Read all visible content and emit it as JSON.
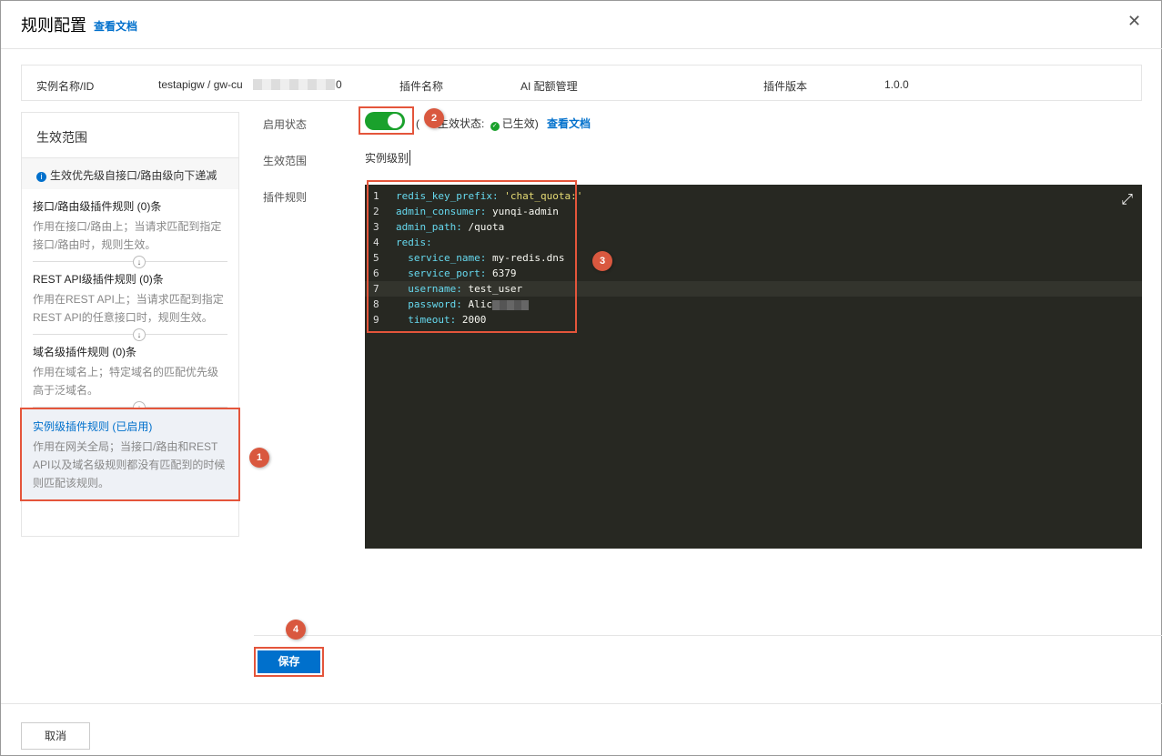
{
  "header": {
    "title": "规则配置",
    "doc_link": "查看文档"
  },
  "info": {
    "instance_label": "实例名称/ID",
    "instance_value": "testapigw / gw-cu",
    "instance_suffix": "0",
    "plugin_name_label": "插件名称",
    "plugin_name": "AI 配额管理",
    "plugin_version_label": "插件版本",
    "plugin_version": "1.0.0"
  },
  "left": {
    "title": "生效范围",
    "tip": "生效优先级自接口/路由级向下递减",
    "rules": [
      {
        "title": "接口/路由级插件规则 (0)条",
        "desc": "作用在接口/路由上；当请求匹配到指定接口/路由时，规则生效。"
      },
      {
        "title": "REST API级插件规则 (0)条",
        "desc": "作用在REST API上；当请求匹配到指定REST API的任意接口时，规则生效。"
      },
      {
        "title": "域名级插件规则 (0)条",
        "desc": "作用在域名上；特定域名的匹配优先级高于泛域名。"
      },
      {
        "title": "实例级插件规则 (已启用)",
        "desc": "作用在网关全局；当接口/路由和REST API以及域名级规则都没有匹配到的时候则匹配该规则。"
      }
    ]
  },
  "form": {
    "status_label": "启用状态",
    "enabled": true,
    "status_prefix": "(",
    "status_text": "生效状态:",
    "status_value": "已生效)",
    "status_doc": "查看文档",
    "scope_label": "生效范围",
    "scope_value": "实例级别",
    "rules_label": "插件规则"
  },
  "code": [
    {
      "n": "1",
      "k": "redis_key_prefix",
      "v": "'chat_quota:'",
      "str": true,
      "indent": ""
    },
    {
      "n": "2",
      "k": "admin_consumer",
      "v": "yunqi-admin",
      "indent": ""
    },
    {
      "n": "3",
      "k": "admin_path",
      "v": "/quota",
      "indent": ""
    },
    {
      "n": "4",
      "k": "redis",
      "v": "",
      "indent": ""
    },
    {
      "n": "5",
      "k": "service_name",
      "v": "my-redis.dns",
      "indent": "  "
    },
    {
      "n": "6",
      "k": "service_port",
      "v": "6379",
      "indent": "  "
    },
    {
      "n": "7",
      "k": "username",
      "v": "test_user",
      "indent": "  "
    },
    {
      "n": "8",
      "k": "password",
      "v": "Alic",
      "indent": "  ",
      "blur": true
    },
    {
      "n": "9",
      "k": "timeout",
      "v": "2000",
      "indent": "  "
    }
  ],
  "buttons": {
    "save": "保存",
    "cancel": "取消"
  },
  "annotations": [
    "1",
    "2",
    "3",
    "4"
  ],
  "colors": {
    "accent": "#0070cc",
    "toggle": "#1aa12c",
    "annotation": "#e4553b",
    "editor_bg": "#272822"
  }
}
